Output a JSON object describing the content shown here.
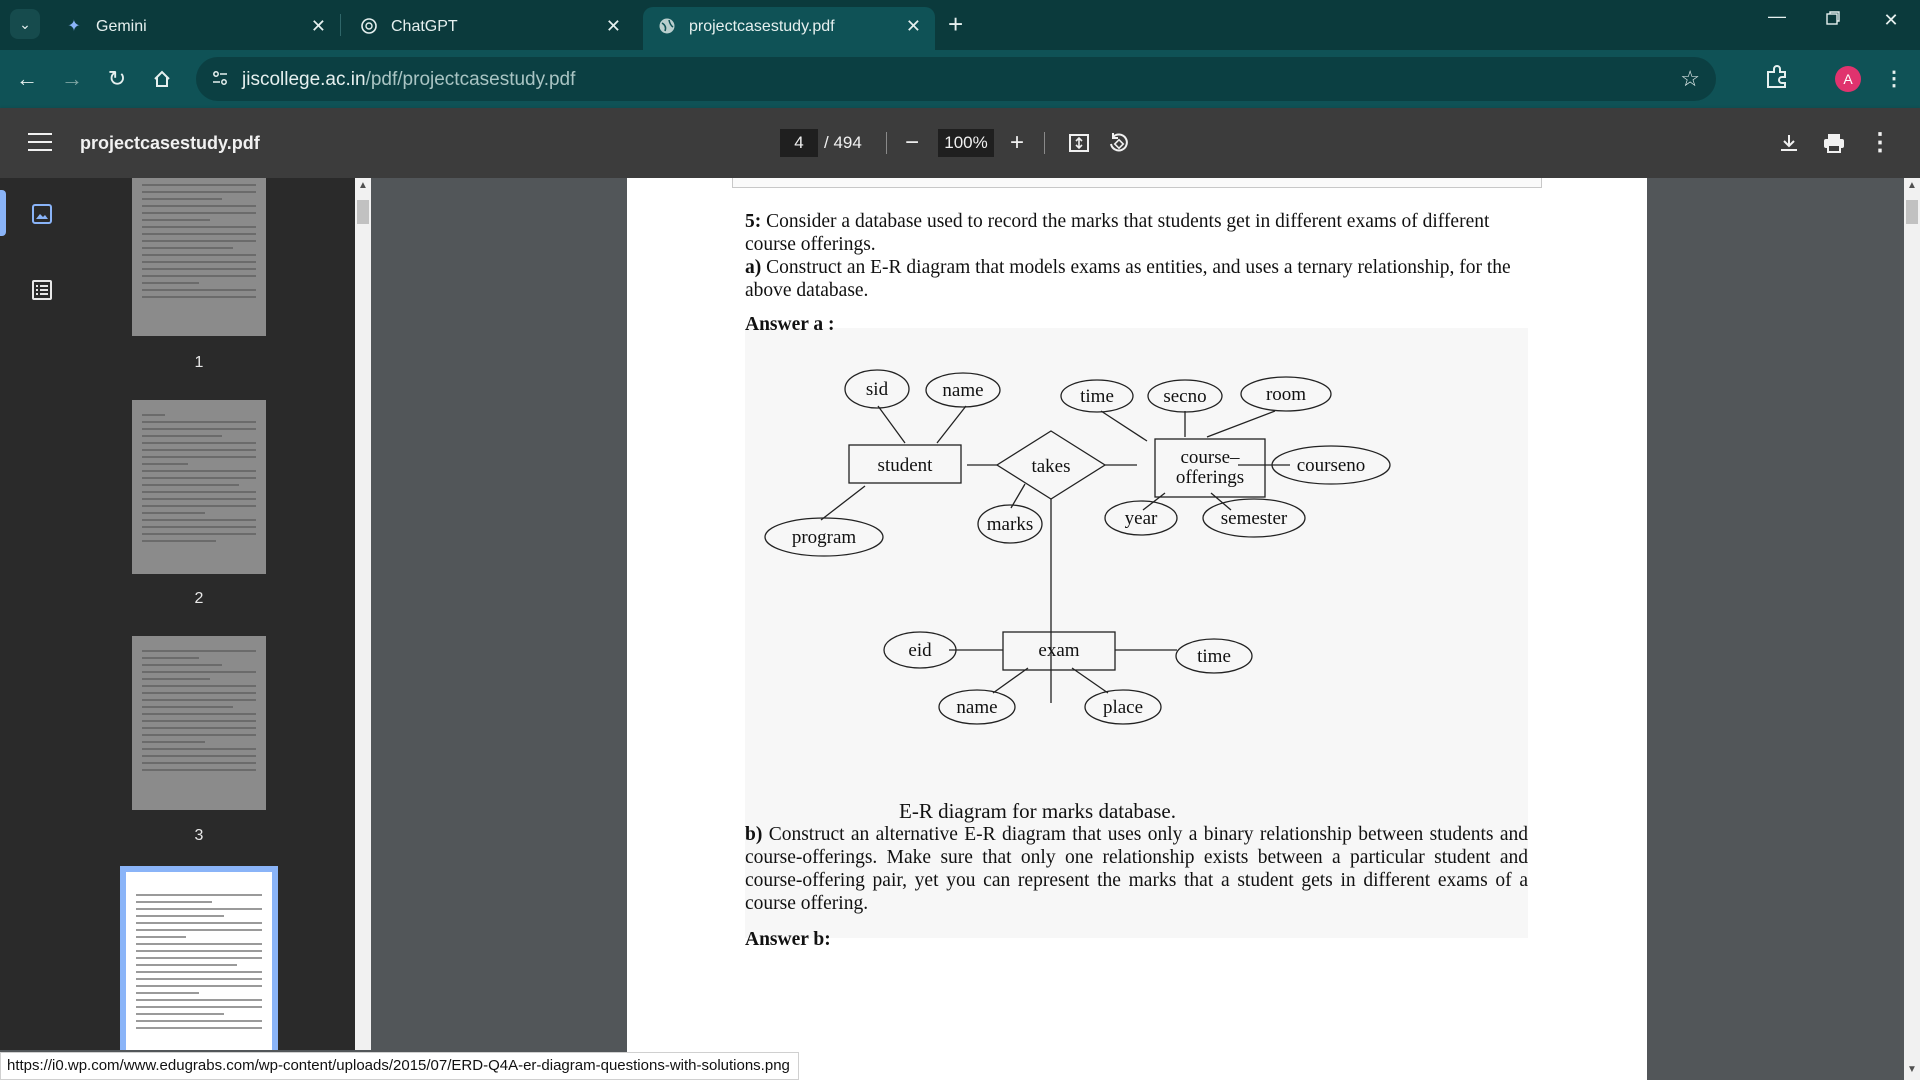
{
  "browser": {
    "tabs": [
      {
        "title": "Gemini",
        "icon": "gemini-sparkle-icon",
        "active": false
      },
      {
        "title": "ChatGPT",
        "icon": "chatgpt-logo-icon",
        "active": false
      },
      {
        "title": "projectcasestudy.pdf",
        "icon": "globe-icon",
        "active": true
      }
    ],
    "new_tab_label": "+",
    "url_host": "jiscollege.ac.in",
    "url_path": "/pdf/projectcasestudy.pdf",
    "profile_initial": "A",
    "accent_color": "#0f5256"
  },
  "pdf_toolbar": {
    "title": "projectcasestudy.pdf",
    "page_current": "4",
    "page_total": "/ 494",
    "zoom": "100%"
  },
  "sidebar": {
    "thumbnails": [
      {
        "page": "1"
      },
      {
        "page": "2"
      },
      {
        "page": "3"
      },
      {
        "page": "4"
      }
    ]
  },
  "document": {
    "q5_label": "5:",
    "q5_text": "Consider a database used to record the marks that students get in different exams of different course offerings.",
    "a_label": "a)",
    "a_text": "Construct an E-R diagram that models exams as entities, and uses a ternary relationship, for the above database.",
    "answer_a": "Answer a :",
    "diagram": {
      "entities": [
        "student",
        "course–",
        "offerings",
        "exam"
      ],
      "relationship": "takes",
      "attributes": [
        "sid",
        "name",
        "time",
        "secno",
        "room",
        "courseno",
        "program",
        "marks",
        "year",
        "semester",
        "eid",
        "time",
        "name",
        "place"
      ]
    },
    "caption": "E-R diagram for marks database.",
    "b_label": "b)",
    "b_text": "Construct an alternative E-R diagram that uses only a binary relationship between students and course-offerings. Make sure that only one relationship exists between a particular student and course-offering pair, yet you can represent the marks that a student gets in different exams of a course offering.",
    "answer_b": "Answer b:"
  },
  "status_link": "https://i0.wp.com/www.edugrabs.com/wp-content/uploads/2015/07/ERD-Q4A-er-diagram-questions-with-solutions.png"
}
